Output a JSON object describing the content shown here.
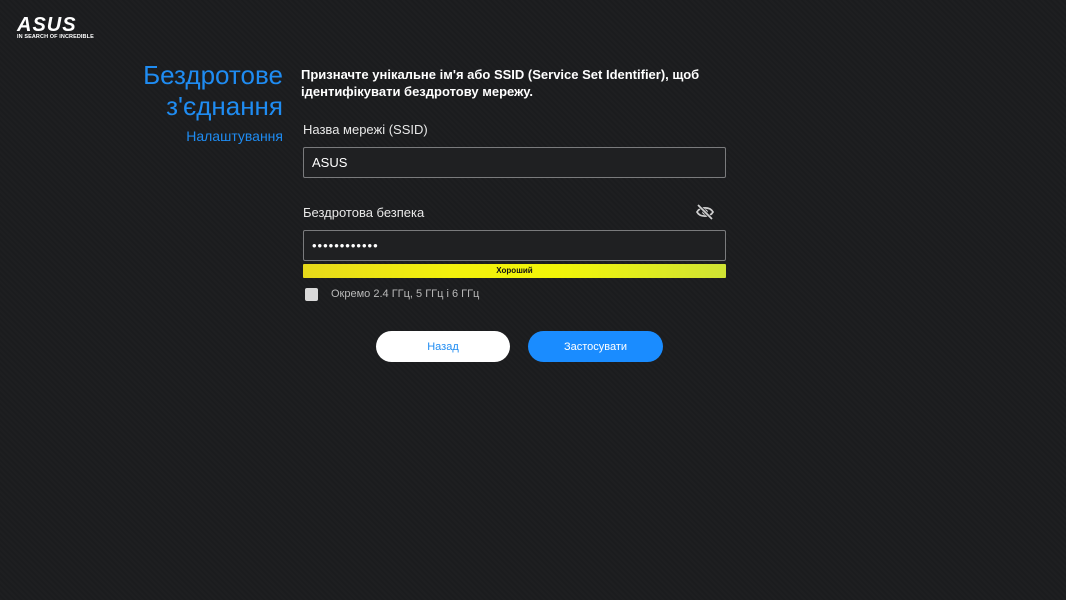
{
  "brand": {
    "logo_text": "ASUS",
    "tagline": "IN SEARCH OF INCREDIBLE"
  },
  "sidebar": {
    "title": "Бездротове з'єднання",
    "subtitle": "Налаштування"
  },
  "main": {
    "description": "Призначте унікальне ім'я або SSID (Service Set Identifier), щоб ідентифікувати бездротову мережу.",
    "ssid": {
      "label": "Назва мережі (SSID)",
      "value": "ASUS"
    },
    "security": {
      "label": "Бездротова безпека",
      "value": "••••••••••••",
      "visibility_icon": "eye-off-icon"
    },
    "strength": {
      "label": "Хороший"
    },
    "separate_bands": {
      "label": "Окремо 2.4 ГГц, 5 ГГц і 6 ГГц",
      "checked": false
    }
  },
  "buttons": {
    "back": "Назад",
    "apply": "Застосувати"
  },
  "colors": {
    "accent": "#1f8cf2",
    "background": "#1b1c1e",
    "strength_bar": "#f2f508"
  }
}
